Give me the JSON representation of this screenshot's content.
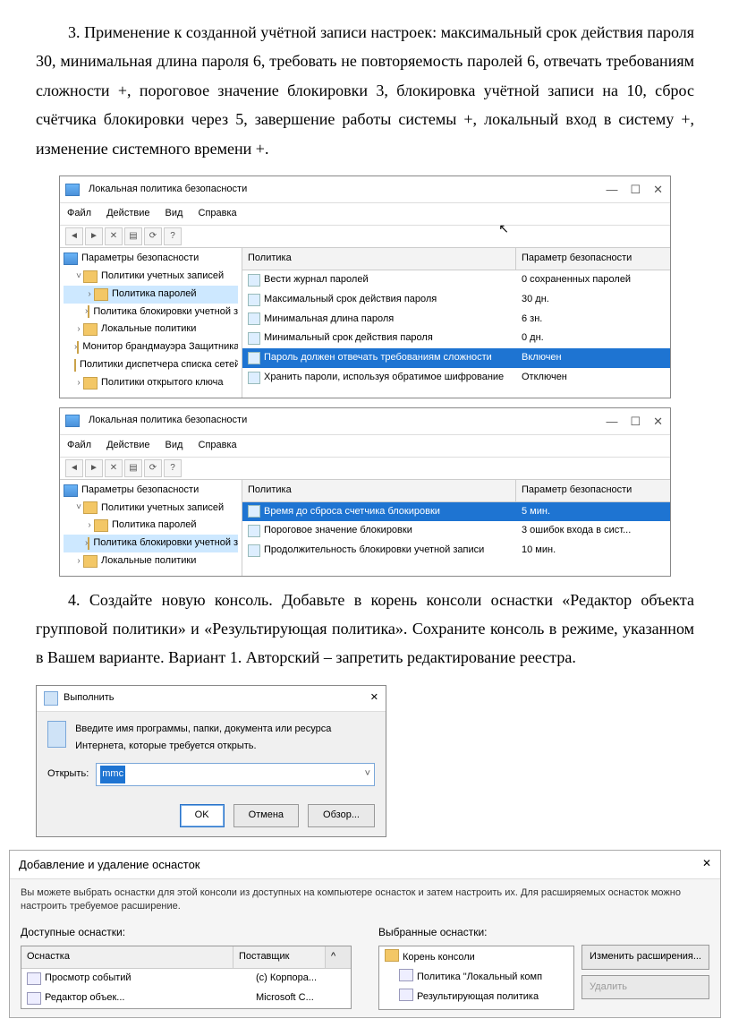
{
  "para3": "3. Применение к созданной учётной записи настроек: максимальный срок действия пароля 30, минимальная длина пароля 6, требовать не повторяемость паролей 6, отвечать требованиям сложности +, пороговое значение блокировки 3, блокировка учётной записи на 10, сброс счётчика блокировки через 5, завершение работы системы +, локальный вход в систему +, изменение системного времени +.",
  "para4": "4. Создайте новую консоль. Добавьте в корень консоли оснастки «Редактор объекта групповой политики» и «Результирующая политика». Сохраните консоль в режиме, указанном в Вашем варианте.  Вариант 1. Авторский – запретить редактирование реестра.",
  "secpol": {
    "title": "Локальная политика безопасности",
    "menu": [
      "Файл",
      "Действие",
      "Вид",
      "Справка"
    ],
    "tree_root": "Параметры безопасности",
    "tree_items": [
      "Политики учетных записей",
      "Политика паролей",
      "Политика блокировки учетной з",
      "Локальные политики",
      "Монитор брандмауэра Защитника",
      "Политики диспетчера списка сетей",
      "Политики открытого ключа"
    ],
    "grid_head": [
      "Политика",
      "Параметр безопасности"
    ],
    "rows1": [
      {
        "p": "Вести журнал паролей",
        "v": "0 сохраненных паролей"
      },
      {
        "p": "Максимальный срок действия пароля",
        "v": "30 дн."
      },
      {
        "p": "Минимальная длина пароля",
        "v": "6 зн."
      },
      {
        "p": "Минимальный срок действия пароля",
        "v": "0 дн."
      },
      {
        "p": "Пароль должен отвечать требованиям сложности",
        "v": "Включен",
        "sel": true
      },
      {
        "p": "Хранить пароли, используя обратимое шифрование",
        "v": "Отключен"
      }
    ],
    "tree2_items": [
      "Политики учетных записей",
      "Политика паролей",
      "Политика блокировки учетной з",
      "Локальные политики"
    ],
    "rows2": [
      {
        "p": "Время до сброса счетчика блокировки",
        "v": "5 мин.",
        "sel": true
      },
      {
        "p": "Пороговое значение блокировки",
        "v": "3 ошибок входа в сист..."
      },
      {
        "p": "Продолжительность блокировки учетной записи",
        "v": "10 мин."
      }
    ]
  },
  "run": {
    "title": "Выполнить",
    "desc": "Введите имя программы, папки, документа или ресурса Интернета, которые требуется открыть.",
    "open_label": "Открыть:",
    "value": "mmc",
    "ok": "OK",
    "cancel": "Отмена",
    "browse": "Обзор..."
  },
  "snap": {
    "title": "Добавление и удаление оснасток",
    "desc": "Вы можете выбрать оснастки для этой консоли из доступных на компьютере оснасток и затем настроить их. Для расширяемых оснасток можно настроить требуемое расширение.",
    "avail_label": "Доступные оснастки:",
    "sel_label": "Выбранные оснастки:",
    "avail_head": [
      "Оснастка",
      "Поставщик"
    ],
    "avail_rows": [
      {
        "n": "Просмотр событий",
        "v": "(c) Корпора..."
      },
      {
        "n": "Редактор объек...",
        "v": "Microsoft C..."
      }
    ],
    "sel_rows": [
      "Корень консоли",
      "Политика \"Локальный комп",
      "Результирующая политика"
    ],
    "btn_edit": "Изменить расширения...",
    "btn_del": "Удалить"
  }
}
